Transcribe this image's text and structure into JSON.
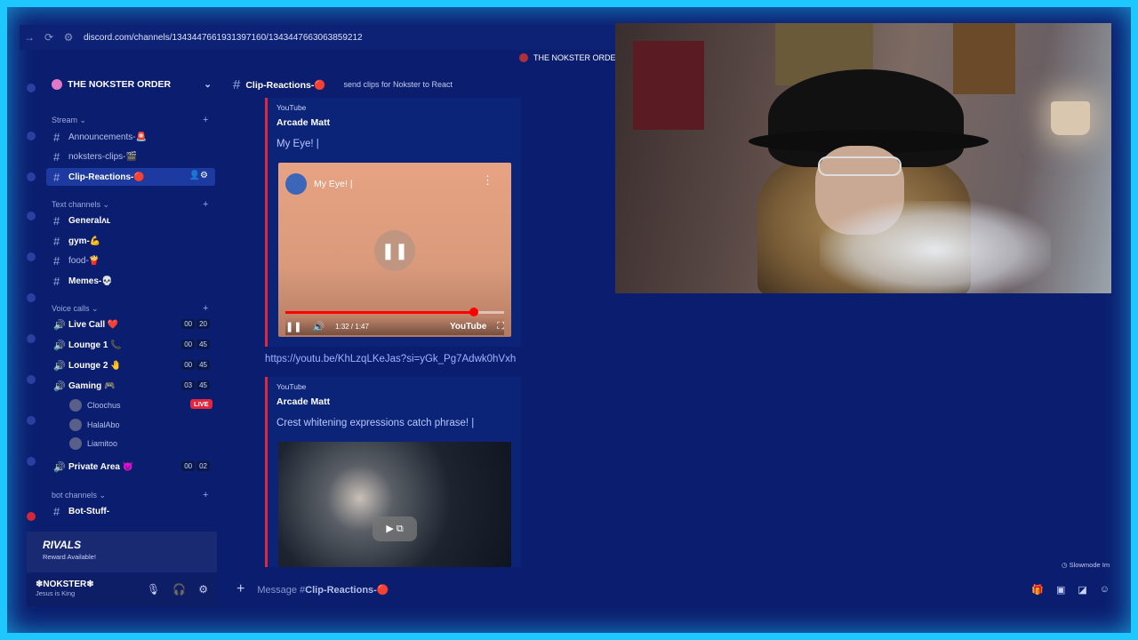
{
  "browser": {
    "url": "discord.com/channels/1343447661931397160/1343447663063859212"
  },
  "server_tag": "THE NOKSTER ORDER",
  "guild": {
    "name": "THE NOKSTER ORDER"
  },
  "categories": {
    "stream": "Stream",
    "text": "Text channels",
    "voice": "Voice calls",
    "bot": "bot channels"
  },
  "channels": {
    "announcements": "Announcements-🚨",
    "nokster_clips": "noksters-clips-🎬",
    "clip_reactions": "Clip-Reactions-🔴",
    "general": "Generalʌʟ",
    "gym": "gym-💪",
    "food": "food-🍟",
    "memes": "Memes-💀",
    "live_call": "Live Call ❤️",
    "lounge1": "Lounge 1 📞",
    "lounge2": "Lounge 2 🤚",
    "gaming": "Gaming 🎮",
    "private": "Private Area 👿",
    "bot_stuff": "Bot-Stuff-"
  },
  "voice_counts": {
    "live_call": [
      "00",
      "20"
    ],
    "lounge1": [
      "00",
      "45"
    ],
    "lounge2": [
      "00",
      "45"
    ],
    "gaming": [
      "03",
      "45"
    ],
    "private": [
      "00",
      "02"
    ]
  },
  "members": [
    "Cloochus",
    "HalalAbo",
    "Liamitoo"
  ],
  "live_badge": "LIVE",
  "rivals": {
    "logo": "RIVALS",
    "sub": "Reward Available!"
  },
  "user": {
    "name": "❄NOKSTER❄",
    "status": "Jesus is King"
  },
  "topbar": {
    "channel": "Clip-Reactions-🔴",
    "topic": "send clips for Nokster to React"
  },
  "embed1": {
    "provider": "YouTube",
    "author": "Arcade Matt",
    "title": "My Eye! |",
    "video_title": "My Eye! |",
    "time": "1:32 / 1:47",
    "progress": 0.86,
    "yt": "YouTube"
  },
  "link": "https://youtu.be/KhLzqLKeJas?si=yGk_Pg7Adwk0hVxh",
  "embed2": {
    "provider": "YouTube",
    "author": "Arcade Matt",
    "title": "Crest whitening expressions catch phrase! |"
  },
  "composer": {
    "prefix": "Message #",
    "channel": "Clip-Reactions-🔴"
  },
  "slowmode": "Slowmode Im"
}
